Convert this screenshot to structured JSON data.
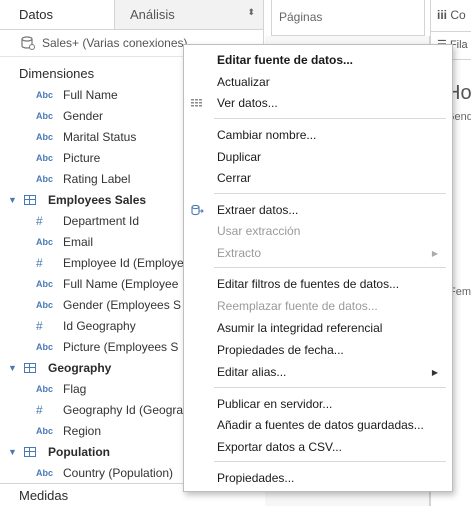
{
  "left_pane": {
    "tabs": {
      "datos": "Datos",
      "analisis": "Análisis"
    },
    "datasource": "Sales+ (Varias conexiones)",
    "dimensiones_label": "Dimensiones",
    "medidas_label": "Medidas",
    "fields_root": [
      {
        "type": "Abc",
        "name": "Full Name"
      },
      {
        "type": "Abc",
        "name": "Gender"
      },
      {
        "type": "Abc",
        "name": "Marital Status"
      },
      {
        "type": "Abc",
        "name": "Picture"
      },
      {
        "type": "Abc",
        "name": "Rating Label"
      }
    ],
    "folder_employees": "Employees Sales",
    "fields_employees": [
      {
        "type": "#",
        "name": "Department Id"
      },
      {
        "type": "Abc",
        "name": "Email"
      },
      {
        "type": "#",
        "name": "Employee Id (Employe"
      },
      {
        "type": "Abc",
        "name": "Full Name (Employee"
      },
      {
        "type": "Abc",
        "name": "Gender (Employees S"
      },
      {
        "type": "#",
        "name": "Id Geography"
      },
      {
        "type": "Abc",
        "name": "Picture (Employees S"
      }
    ],
    "folder_geography": "Geography",
    "fields_geography": [
      {
        "type": "Abc",
        "name": "Flag"
      },
      {
        "type": "#",
        "name": "Geography Id (Geogra"
      },
      {
        "type": "Abc",
        "name": "Region"
      }
    ],
    "folder_population": "Population",
    "fields_population": [
      {
        "type": "Abc",
        "name": "Country (Population)"
      }
    ]
  },
  "paginas_label": "Páginas",
  "right_pane": {
    "columns_label": "Co",
    "rows_label": "Fila",
    "sheet_title": "Hoj",
    "sheet_sub": "Gend",
    "sheet_fem": "Fem"
  },
  "context_menu": {
    "items": [
      {
        "label": "Editar fuente de datos...",
        "bold": true,
        "disabled": false
      },
      {
        "label": "Actualizar",
        "bold": false,
        "disabled": false
      },
      {
        "label": "Ver datos...",
        "bold": false,
        "disabled": false,
        "icon": "table-grid-icon"
      },
      {
        "label": "Cambiar nombre...",
        "bold": false,
        "disabled": false
      },
      {
        "label": "Duplicar",
        "bold": false,
        "disabled": false
      },
      {
        "label": "Cerrar",
        "bold": false,
        "disabled": false
      },
      {
        "label": "Extraer datos...",
        "bold": false,
        "disabled": false,
        "icon": "extract-icon"
      },
      {
        "label": "Usar extracción",
        "bold": false,
        "disabled": true
      },
      {
        "label": "Extracto",
        "bold": false,
        "disabled": true,
        "submenu": true
      },
      {
        "label": "Editar filtros de fuentes de datos...",
        "bold": false,
        "disabled": false
      },
      {
        "label": "Reemplazar fuente de datos...",
        "bold": false,
        "disabled": true
      },
      {
        "label": "Asumir la integridad referencial",
        "bold": false,
        "disabled": false
      },
      {
        "label": "Propiedades de fecha...",
        "bold": false,
        "disabled": false
      },
      {
        "label": "Editar alias...",
        "bold": false,
        "disabled": false,
        "submenu": true
      },
      {
        "label": "Publicar en servidor...",
        "bold": false,
        "disabled": false
      },
      {
        "label": "Añadir a fuentes de datos guardadas...",
        "bold": false,
        "disabled": false
      },
      {
        "label": "Exportar datos a CSV...",
        "bold": false,
        "disabled": false
      },
      {
        "label": "Propiedades...",
        "bold": false,
        "disabled": false
      }
    ],
    "submenu_glyph": "▶"
  },
  "colors": {
    "accent_blue": "#4a7ab6",
    "disabled_text": "#9a9a9a",
    "border": "#d4d4d4"
  }
}
